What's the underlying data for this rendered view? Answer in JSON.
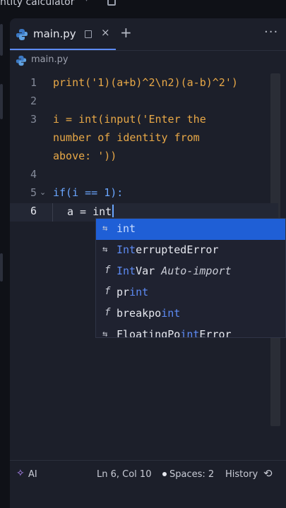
{
  "window": {
    "title": "ntity calculator"
  },
  "tab": {
    "label": "main.py",
    "close": "×",
    "add": "+",
    "more": "···"
  },
  "breadcrumb": {
    "file": "main.py"
  },
  "editor": {
    "lines": [
      {
        "num": "1",
        "text": "print('1)(a+b)^2\\n2)(a-b)^2')"
      },
      {
        "num": "2",
        "text": ""
      },
      {
        "num": "3",
        "text": "i = int(input('Enter the",
        "wrap": [
          "number of identity from",
          "above: '))"
        ]
      },
      {
        "num": "4",
        "text": ""
      },
      {
        "num": "5",
        "text": "if(i == 1):"
      },
      {
        "num": "6",
        "text_a": "a = ",
        "text_b": "int"
      }
    ]
  },
  "autocomplete": {
    "items": [
      {
        "icon": "⇆",
        "pre": "",
        "match": "int",
        "post": ""
      },
      {
        "icon": "⇆",
        "pre": "",
        "match": "Int",
        "post": "erruptedError"
      },
      {
        "icon": "f",
        "pre": "",
        "match": "Int",
        "post": "Var",
        "extra": "Auto-import"
      },
      {
        "icon": "f",
        "pre": "pr",
        "match": "int",
        "post": ""
      },
      {
        "icon": "f",
        "pre": "breakpo",
        "match": "int",
        "post": ""
      },
      {
        "icon": "⇆",
        "pre": "FloatingPo",
        "match": "int",
        "post": "Error"
      }
    ]
  },
  "status": {
    "ai": "AI",
    "position": "Ln 6, Col 10",
    "spaces": "Spaces: 2",
    "history": "History"
  },
  "colors": {
    "accent": "#5d8bf4",
    "selection": "#1f5fd6",
    "string": "#e8a847",
    "keyword": "#6aa6ff"
  }
}
